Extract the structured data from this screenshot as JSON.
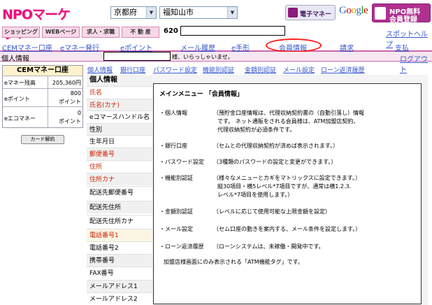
{
  "header": {
    "logo": "NPOマーケット",
    "prefecture": "京都府",
    "city": "福知山市",
    "emoney_button": "電子マネー",
    "google": [
      "G",
      "o",
      "o",
      "g",
      "l",
      "e"
    ],
    "register_line1": "NPO無料",
    "register_line2": "会員登録"
  },
  "top_nav": {
    "items": [
      "ショッピング",
      "WEBページ",
      "求人・求職",
      "不 動 産"
    ],
    "user_id_prefix": "620",
    "spot_help": "スポットヘルプ"
  },
  "main_tabs": [
    "CEMマネー口座",
    "eマネー発行",
    "eポイント",
    "メール履歴",
    "e手形",
    "会員情報",
    "請求",
    "支払"
  ],
  "user_bar": {
    "label": "個人情報",
    "greeting": "様、いらっしゃいませ。",
    "logout": "ログアウト"
  },
  "cem_account": {
    "title": "CEMマネー口座",
    "rows": [
      {
        "label": "eマネー残高",
        "value": "205,360円"
      },
      {
        "label": "eポイント",
        "value": "800",
        "value2": "ポイント"
      },
      {
        "label": "eエコマネー",
        "value": "0",
        "value2": "ポイント"
      }
    ],
    "card_button": "カード解約"
  },
  "sub_nav": [
    "個人情報",
    "銀行口座",
    "パスワード設定",
    "機能別認証",
    "金額別認証",
    "メール設定",
    "ローン返済履歴"
  ],
  "form": {
    "title": "個人情報",
    "fields": [
      {
        "label": "氏名",
        "required": true
      },
      {
        "label": "氏名(カナ)",
        "required": true
      },
      {
        "label": "eコマースハンドル名",
        "required": false
      },
      {
        "label": "性別",
        "required": false
      },
      {
        "label": "生年月日",
        "required": false
      },
      {
        "label": "郵便番号",
        "required": true
      },
      {
        "label": "住所",
        "required": true
      },
      {
        "label": "住所カナ",
        "required": true
      },
      {
        "label": "配送先郵便番号",
        "required": false
      },
      {
        "label": "配送先住所",
        "required": false
      },
      {
        "label": "配送先住所カナ",
        "required": false
      },
      {
        "label": "電話番号1",
        "required": true
      },
      {
        "label": "電話番号2",
        "required": false
      },
      {
        "label": "携帯番号",
        "required": false
      },
      {
        "label": "FAX番号",
        "required": false
      },
      {
        "label": "メールアドレス1",
        "required": false
      },
      {
        "label": "メールアドレス2",
        "required": false
      }
    ]
  },
  "overlay": {
    "title": "メインメニュー 「会員情報」",
    "items": [
      {
        "name": "・個人情報",
        "lines": [
          "（預貯金口座情報は、代理収納契約書の（自動引落し）情報",
          "です。 ネット通販をされる会員様は、ATM加盟店契約、",
          "代理収納契約が必須条件です。"
        ]
      },
      {
        "name": "・銀行口座",
        "lines": [
          "（セムとの代理収納契約が済めば表示されます。）"
        ]
      },
      {
        "name": "・パスワード設定",
        "lines": [
          "（3種類のパスワードの設定と変更ができます。）"
        ]
      },
      {
        "name": "・機能別認証",
        "lines": [
          "（様々なメニューとカギをマトリックスに設定できます。）",
          "縦30項目・横5レベル*7項目ですが、通常は横1.2.3.",
          "レベル*7項目を使用します。）"
        ]
      },
      {
        "name": "・金額別認証",
        "lines": [
          "（レベルに応じて使用可能な上限金額を設定）"
        ]
      },
      {
        "name": "・メール設定",
        "lines": [
          "（セム口座の動きを案内する、メール条件を設定します。）"
        ]
      },
      {
        "name": "・ローン返済履歴",
        "lines": [
          "（ローンシステムは、未稼働・開発中です。"
        ]
      }
    ],
    "footer": "加盟店様画面にのみ表示される「ATM機能タグ」です。"
  }
}
